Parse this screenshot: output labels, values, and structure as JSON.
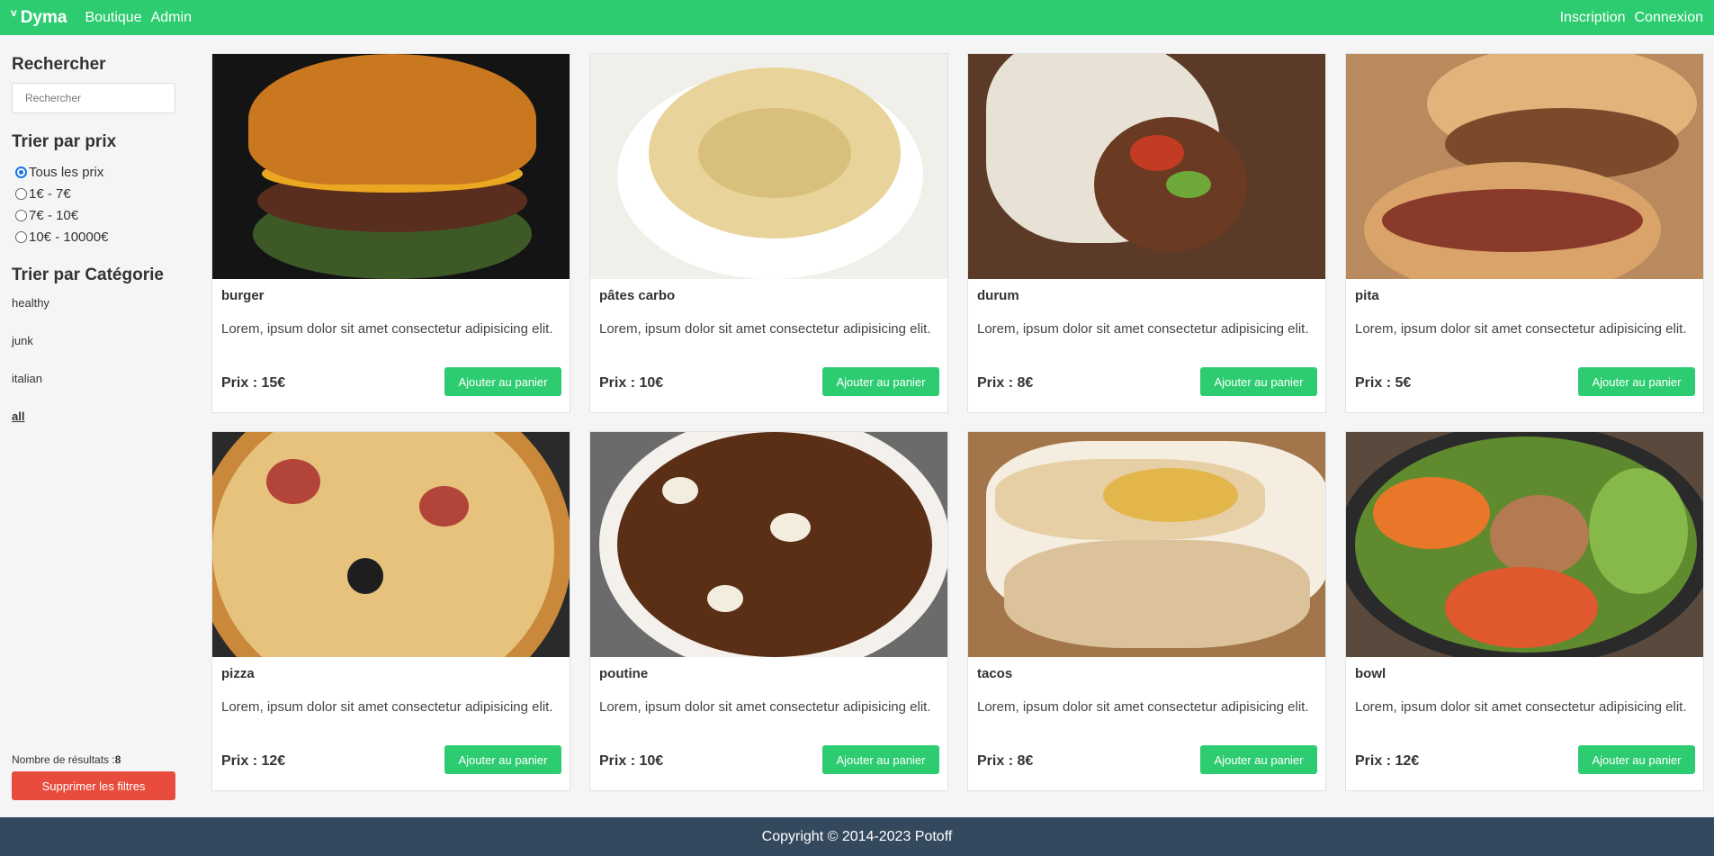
{
  "header": {
    "logo_icon": "v",
    "brand": "Dyma",
    "nav_left": [
      "Boutique",
      "Admin"
    ],
    "nav_right": [
      "Inscription",
      "Connexion"
    ]
  },
  "sidebar": {
    "search_heading": "Rechercher",
    "search_placeholder": "Rechercher",
    "price_heading": "Trier par prix",
    "price_options": [
      {
        "label": "Tous les prix",
        "checked": true
      },
      {
        "label": "1€ - 7€",
        "checked": false
      },
      {
        "label": "7€ - 10€",
        "checked": false
      },
      {
        "label": "10€ - 10000€",
        "checked": false
      }
    ],
    "category_heading": "Trier par Catégorie",
    "categories": [
      "healthy",
      "junk",
      "italian",
      "all"
    ],
    "active_category": "all",
    "results_label": "Nombre de résultats :",
    "results_count": "8",
    "clear_label": "Supprimer les filtres"
  },
  "products": [
    {
      "name": "burger",
      "desc": "Lorem, ipsum dolor sit amet consectetur adipisicing elit.",
      "price": "Prix : 15€",
      "button": "Ajouter au panier",
      "image": "burger-photo"
    },
    {
      "name": "pâtes carbo",
      "desc": "Lorem, ipsum dolor sit amet consectetur adipisicing elit.",
      "price": "Prix : 10€",
      "button": "Ajouter au panier",
      "image": "pasta-photo"
    },
    {
      "name": "durum",
      "desc": "Lorem, ipsum dolor sit amet consectetur adipisicing elit.",
      "price": "Prix : 8€",
      "button": "Ajouter au panier",
      "image": "durum-photo"
    },
    {
      "name": "pita",
      "desc": "Lorem, ipsum dolor sit amet consectetur adipisicing elit.",
      "price": "Prix : 5€",
      "button": "Ajouter au panier",
      "image": "pita-photo"
    },
    {
      "name": "pizza",
      "desc": "Lorem, ipsum dolor sit amet consectetur adipisicing elit.",
      "price": "Prix : 12€",
      "button": "Ajouter au panier",
      "image": "pizza-photo"
    },
    {
      "name": "poutine",
      "desc": "Lorem, ipsum dolor sit amet consectetur adipisicing elit.",
      "price": "Prix : 10€",
      "button": "Ajouter au panier",
      "image": "poutine-photo"
    },
    {
      "name": "tacos",
      "desc": "Lorem, ipsum dolor sit amet consectetur adipisicing elit.",
      "price": "Prix : 8€",
      "button": "Ajouter au panier",
      "image": "tacos-photo"
    },
    {
      "name": "bowl",
      "desc": "Lorem, ipsum dolor sit amet consectetur adipisicing elit.",
      "price": "Prix : 12€",
      "button": "Ajouter au panier",
      "image": "bowl-photo"
    }
  ],
  "footer": {
    "copyright": "Copyright © 2014-2023 Potoff"
  },
  "colors": {
    "accent": "#2ecc71",
    "danger": "#e74c3c",
    "footer": "#34495e"
  }
}
